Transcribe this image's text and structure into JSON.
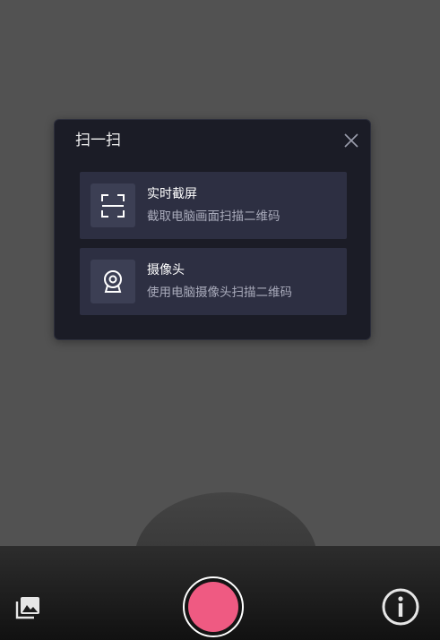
{
  "dialog": {
    "title": "扫一扫",
    "close_icon": "close-icon",
    "options": [
      {
        "title": "实时截屏",
        "description": "截取电脑画面扫描二维码",
        "icon": "screenshot-frame-icon"
      },
      {
        "title": "摄像头",
        "description": "使用电脑摄像头扫描二维码",
        "icon": "webcam-icon"
      }
    ]
  },
  "bottom_bar": {
    "gallery_icon": "gallery-icon",
    "shutter_icon": "shutter-icon",
    "info_icon": "info-icon"
  },
  "colors": {
    "background": "#525252",
    "dialog": "#1b1c26",
    "option": "#2d2f42",
    "shutter": "#ef5a82"
  }
}
